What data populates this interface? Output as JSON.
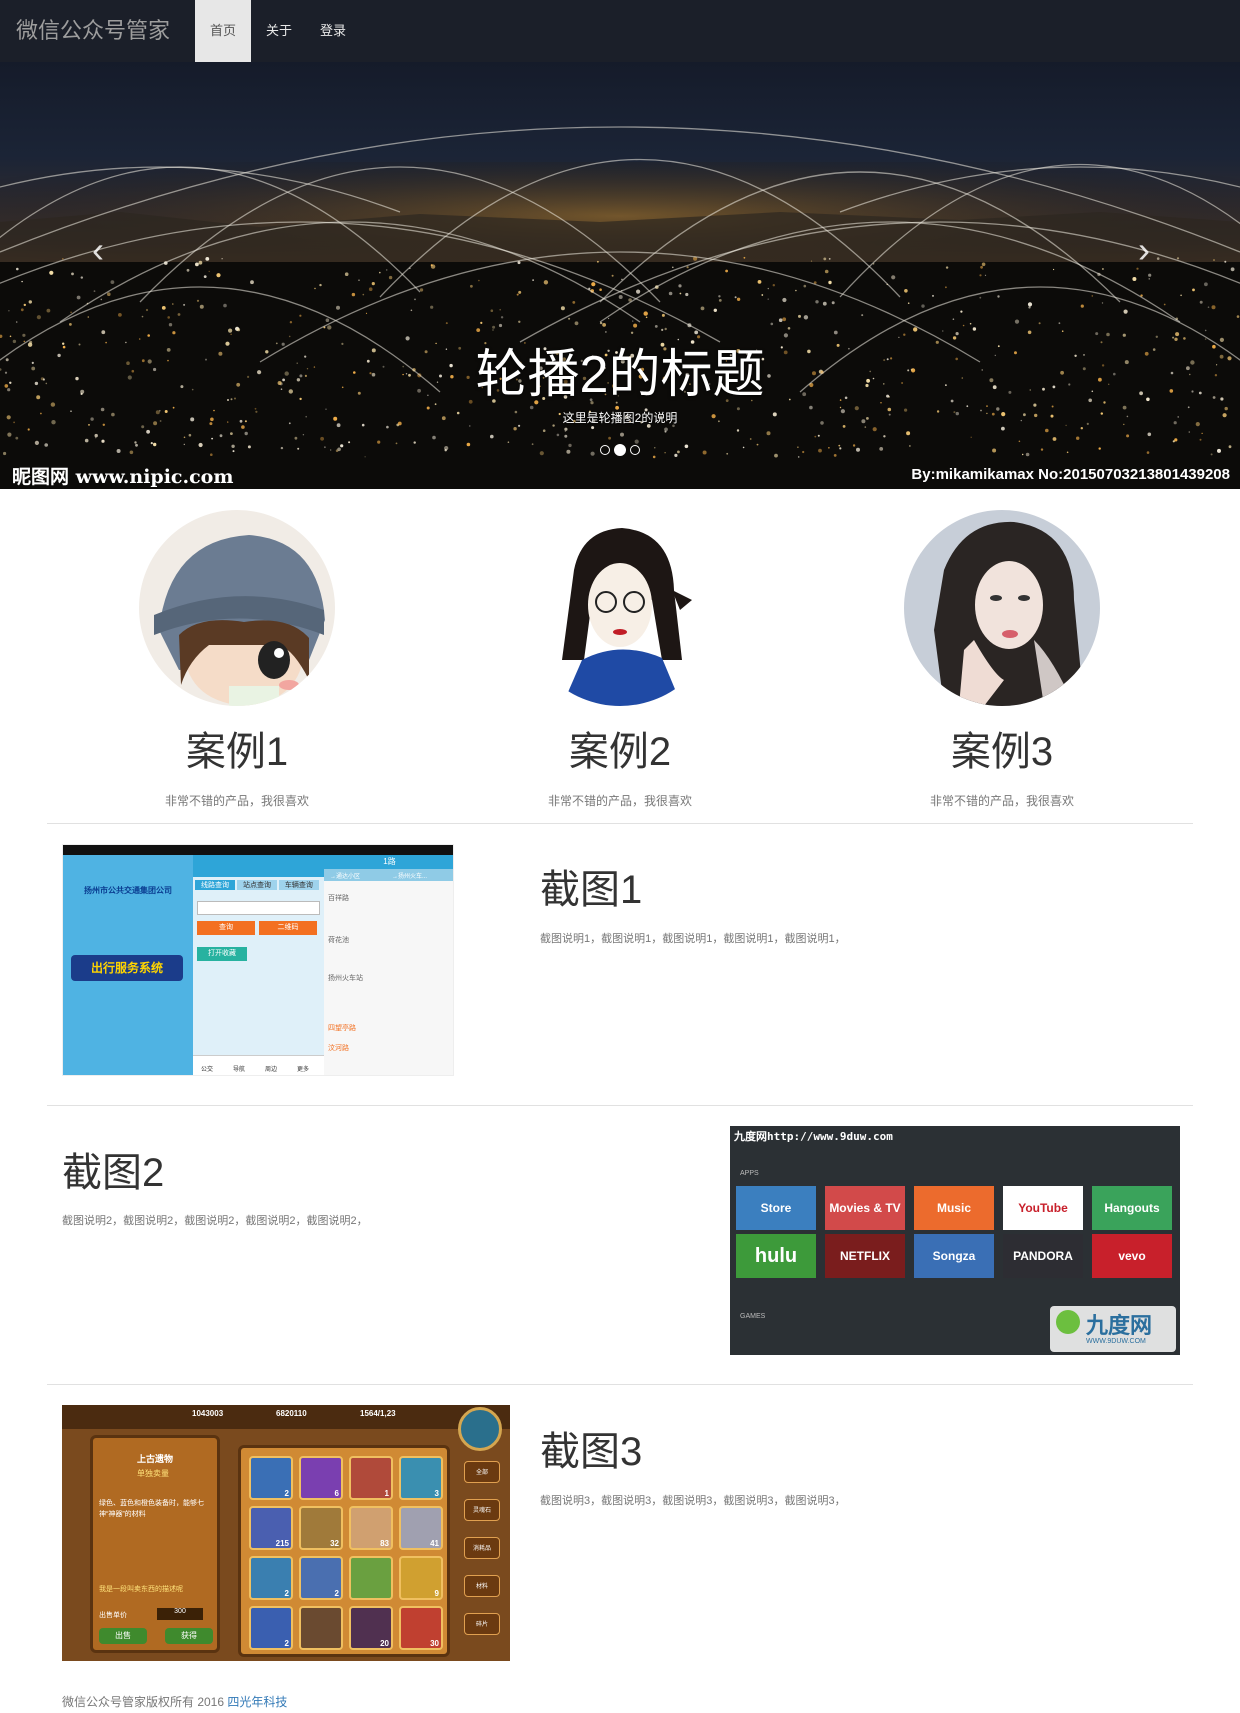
{
  "navbar": {
    "brand": "微信公众号管家",
    "items": [
      {
        "label": "首页",
        "active": true
      },
      {
        "label": "关于",
        "active": false
      },
      {
        "label": "登录",
        "active": false
      }
    ]
  },
  "carousel": {
    "title": "轮播2的标题",
    "description": "这里是轮播图2的说明",
    "active_index": 1,
    "slide_count": 3,
    "prev_icon": "chevron-left-icon",
    "next_icon": "chevron-right-icon",
    "watermark_left": "昵图网 www.nipic.com",
    "watermark_right": "By:mikamikamax No:20150703213801439208"
  },
  "cases": [
    {
      "title": "案例1",
      "text": "非常不错的产品，我很喜欢"
    },
    {
      "title": "案例2",
      "text": "非常不错的产品，我很喜欢"
    },
    {
      "title": "案例3",
      "text": "非常不错的产品，我很喜欢"
    }
  ],
  "features": [
    {
      "title": "截图1",
      "text": "截图说明1，截图说明1，截图说明1，截图说明1，截图说明1，"
    },
    {
      "title": "截图2",
      "text": "截图说明2，截图说明2，截图说明2，截图说明2，截图说明2，"
    },
    {
      "title": "截图3",
      "text": "截图说明3，截图说明3，截图说明3，截图说明3，截图说明3，"
    }
  ],
  "screenshot1": {
    "company": "扬州市公共交通集团公司",
    "badge": "出行服务系统",
    "tabs": [
      "线路查询",
      "站点查询",
      "车辆查询"
    ],
    "buttons": [
      "查询",
      "二维码",
      "打开收藏"
    ],
    "route": "1路",
    "directions": [
      "→通达小区",
      "→扬州火车..."
    ],
    "stops": [
      "百祥路",
      "荷花池",
      "扬州火车站",
      "四望亭路",
      "汶河路"
    ],
    "bottom_nav": [
      "公交",
      "导航",
      "周边",
      "更多"
    ]
  },
  "screenshot2": {
    "header": "九度网http://www.9duw.com",
    "apps_label": "APPS",
    "games_label": "GAMES",
    "row1": [
      "Store",
      "Movies & TV",
      "Music",
      "YouTube",
      "Hangouts"
    ],
    "row2": [
      "hulu",
      "NETFLIX",
      "Songza",
      "PANDORA",
      "vevo"
    ],
    "logo": "九度网",
    "logo_sub": "WWW.9DUW.COM"
  },
  "screenshot3": {
    "stats": [
      "1043003",
      "6820110",
      "1564/1,23"
    ],
    "panel_title": "上古遗物",
    "panel_sub": "单独卖量",
    "panel_text": "绿色、蓝色和橙色装备时，能够七神“神器”的材料",
    "panel_hint": "我是一段叫卖东西的描述呢",
    "price_label": "出售单价",
    "price": "300",
    "buttons": [
      "出售",
      "获得"
    ],
    "side_tabs": [
      "全部",
      "灵魂石",
      "消耗品",
      "材料",
      "碎片"
    ],
    "counts": [
      "2",
      "6",
      "1",
      "3",
      "215",
      "32",
      "83",
      "41",
      "2",
      "2",
      "",
      "9",
      "2",
      "",
      "20",
      "30"
    ]
  },
  "footer": {
    "text": "微信公众号管家版权所有 2016",
    "link": "四光年科技"
  },
  "colors": {
    "navbar": "#1b1f29",
    "active_nav": "#e7e7e7",
    "link": "#337ab7"
  }
}
